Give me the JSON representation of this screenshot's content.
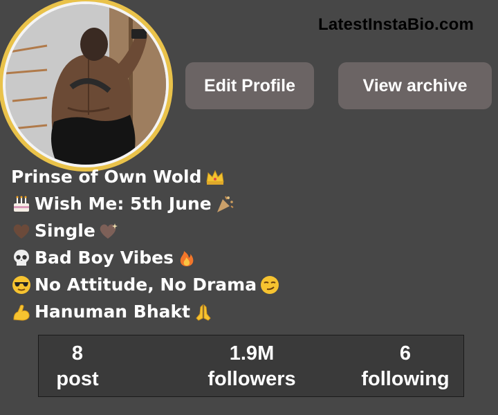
{
  "watermark": "LatestInstaBio.com",
  "buttons": {
    "edit_profile": "Edit Profile",
    "view_archive": "View archive"
  },
  "bio": [
    {
      "text": "Prinse of Own Wold",
      "icon_after": "crown-icon"
    },
    {
      "icon_before": "birthday-cake-icon",
      "text": "Wish Me: 5th June",
      "icon_after": "party-popper-icon"
    },
    {
      "icon_before": "brown-heart-icon",
      "text": "Single",
      "icon_after": "sparkling-heart-icon"
    },
    {
      "icon_before": "skull-icon",
      "text": "Bad Boy Vibes",
      "icon_after": "fire-icon"
    },
    {
      "icon_before": "sunglasses-face-icon",
      "text": "No Attitude, No Drama",
      "icon_after": "smirk-face-icon"
    },
    {
      "icon_before": "flexed-biceps-icon",
      "text": "Hanuman Bhakt",
      "icon_after": "folded-hands-icon"
    }
  ],
  "stats": {
    "posts": {
      "value": "8",
      "label": "post"
    },
    "followers": {
      "value": "1.9M",
      "label": "followers"
    },
    "following": {
      "value": "6",
      "label": "following"
    }
  },
  "colors": {
    "background": "#474747",
    "button": "#6b6464",
    "avatar_ring": "#e9c24a",
    "stats_box": "#3a3a3a"
  }
}
